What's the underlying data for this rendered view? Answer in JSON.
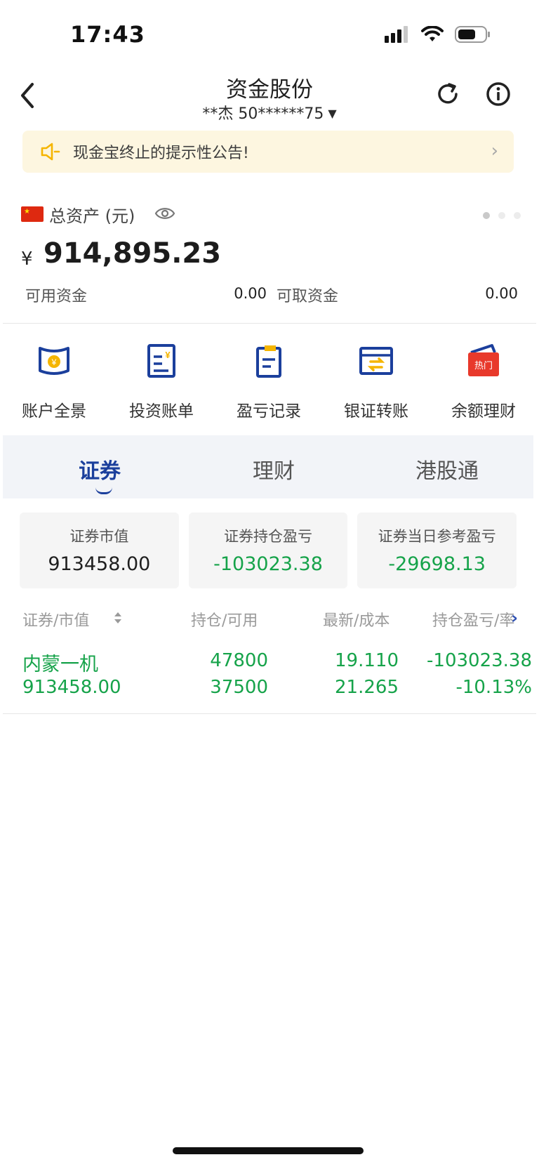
{
  "status_bar": {
    "time": "17:43",
    "icons": [
      "signal-icon",
      "wifi-icon",
      "battery-icon"
    ]
  },
  "nav": {
    "title": "资金股份",
    "account": "**杰 50******75",
    "icons": [
      "back-icon",
      "refresh-icon",
      "info-icon"
    ]
  },
  "notice": {
    "text": "现金宝终止的提示性公告!"
  },
  "assets": {
    "label": "总资产 (元)",
    "currency_symbol": "¥",
    "total": "914,895.23",
    "available_label": "可用资金",
    "available_value": "0.00",
    "withdrawable_label": "可取资金",
    "withdrawable_value": "0.00"
  },
  "quick_actions": [
    {
      "label": "账户全景",
      "icon": "account-overview-icon"
    },
    {
      "label": "投资账单",
      "icon": "bill-icon"
    },
    {
      "label": "盈亏记录",
      "icon": "profit-record-icon"
    },
    {
      "label": "银证转账",
      "icon": "transfer-icon"
    },
    {
      "label": "余额理财",
      "icon": "wallet-icon",
      "badge": "热门"
    }
  ],
  "tabs": [
    {
      "label": "证券",
      "active": true
    },
    {
      "label": "理财",
      "active": false
    },
    {
      "label": "港股通",
      "active": false
    }
  ],
  "summary": [
    {
      "label": "证券市值",
      "value": "913458.00"
    },
    {
      "label": "证券持仓盈亏",
      "value": "-103023.38"
    },
    {
      "label": "证券当日参考盈亏",
      "value": "-29698.13"
    }
  ],
  "table": {
    "headers": [
      "证券/市值",
      "持仓/可用",
      "最新/成本",
      "持仓盈亏/率"
    ],
    "rows": [
      {
        "name": "内蒙一机",
        "market_value": "913458.00",
        "position": "47800",
        "available": "37500",
        "latest": "19.110",
        "cost": "21.265",
        "pnl": "-103023.38",
        "pnl_rate": "-10.13%"
      }
    ]
  },
  "colors": {
    "accent": "#1b3f9c",
    "loss_green": "#16a34a",
    "notice_bg": "#fdf6e0",
    "badge_red": "#e8392b",
    "icon_yellow": "#f5b500"
  }
}
